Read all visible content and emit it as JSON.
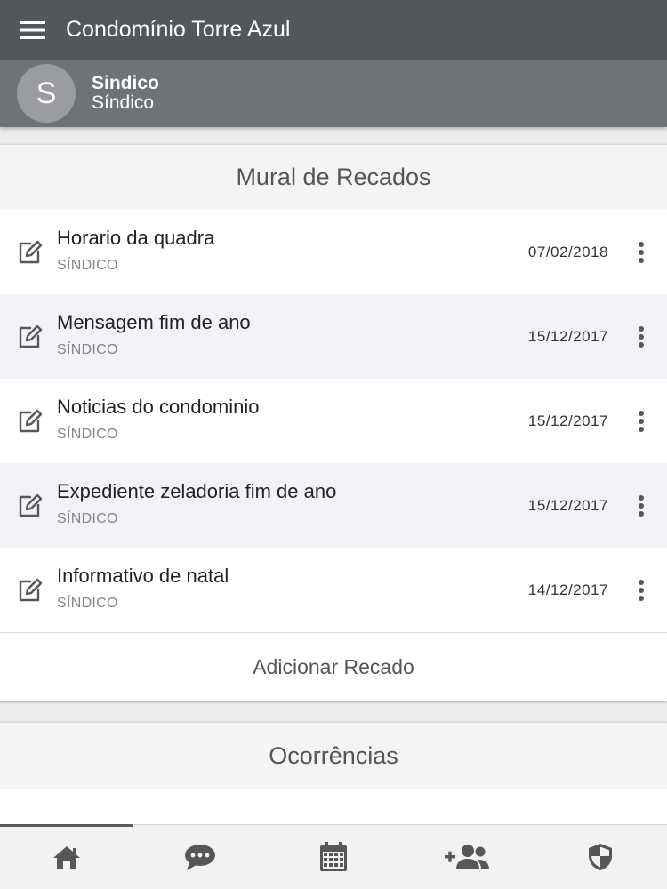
{
  "app": {
    "title": "Condomínio Torre Azul",
    "menu_icon": "hamburger-menu-icon"
  },
  "user": {
    "avatar_letter": "S",
    "name": "Sindico",
    "role": "Síndico"
  },
  "mural": {
    "title": "Mural de Recados",
    "items": [
      {
        "title": "Horario da quadra",
        "author": "SÍNDICO",
        "date": "07/02/2018"
      },
      {
        "title": "Mensagem fim de ano",
        "author": "SÍNDICO",
        "date": "15/12/2017"
      },
      {
        "title": "Noticias do condominio",
        "author": "SÍNDICO",
        "date": "15/12/2017"
      },
      {
        "title": "Expediente zeladoria fim de ano",
        "author": "SÍNDICO",
        "date": "15/12/2017"
      },
      {
        "title": "Informativo de natal",
        "author": "SÍNDICO",
        "date": "14/12/2017"
      }
    ],
    "add_label": "Adicionar Recado"
  },
  "ocorrencias": {
    "title": "Ocorrências"
  },
  "bottom_nav": {
    "items": [
      "home-icon",
      "chat-icon",
      "calendar-icon",
      "add-user-icon",
      "shield-icon"
    ],
    "active_index": 0
  },
  "colors": {
    "appbar": "#545759",
    "userbar": "#707376",
    "icon": "#555759"
  }
}
